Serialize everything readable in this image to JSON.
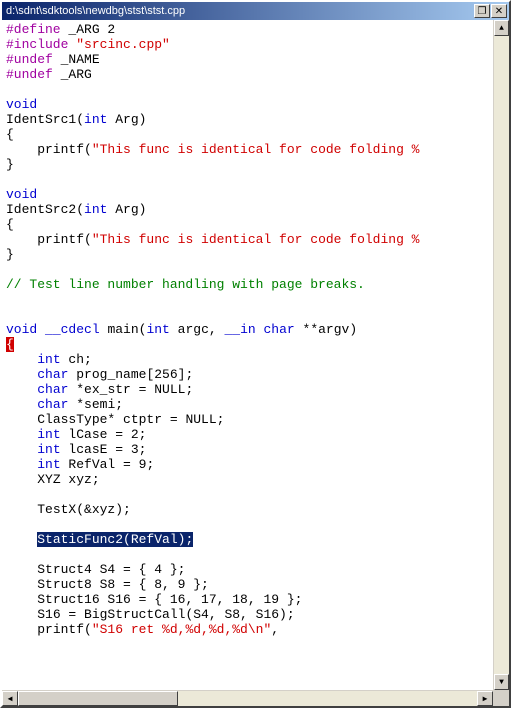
{
  "window": {
    "title": "d:\\sdnt\\sdktools\\newdbg\\stst\\stst.cpp",
    "restore_icon": "❐",
    "close_icon": "✕"
  },
  "code": {
    "l1a": "#define",
    "l1b": " _ARG 2",
    "l2a": "#include",
    "l2b": " ",
    "l2c": "\"srcinc.cpp\"",
    "l3a": "#undef",
    "l3b": " _NAME",
    "l4a": "#undef",
    "l4b": " _ARG",
    "blank": "",
    "void": "void",
    "int": "int",
    "char": "char",
    "cdecl": "__cdecl",
    "in": "__in",
    "f1name": "IdentSrc1(",
    "f1arg": " Arg)",
    "f2name": "IdentSrc2(",
    "f2arg": " Arg)",
    "lbrace": "{",
    "rbrace": "}",
    "printf_pre": "    printf(",
    "printf_str": "\"This func is identical for code folding %",
    "cmt1": "// Test line number handling with page breaks.",
    "main_sp": " ",
    "main_name": " main(",
    "main_argc": " argc, ",
    "main_argv": " **argv)",
    "cursor_brace": "{",
    "indent": "    ",
    "m_int": "int",
    "m_char": "char",
    "decl_ch": " ch;",
    "decl_prog": " prog_name[256];",
    "decl_ex": " *ex_str = NULL;",
    "decl_semi": " *semi;",
    "decl_ct": "ClassType* ctptr = NULL;",
    "decl_lcase": " lCase = 2;",
    "decl_lcasE": " lcasE = 3;",
    "decl_ref": " RefVal = 9;",
    "decl_xyz": "XYZ xyz;",
    "testx": "TestX(&xyz);",
    "staticfunc": "StaticFunc2(RefVal);",
    "s4": "Struct4 S4 = { 4 };",
    "s8": "Struct8 S8 = { 8, 9 };",
    "s16": "Struct16 S16 = { 16, 17, 18, 19 };",
    "bigcall": "S16 = BigStructCall(S4, S8, S16);",
    "printf2_pre": "printf(",
    "printf2_str": "\"S16 ret %d,%d,%d,%d\\n\"",
    "printf2_end": ","
  },
  "scroll": {
    "up": "▲",
    "down": "▼",
    "left": "◀",
    "right": "▶"
  }
}
